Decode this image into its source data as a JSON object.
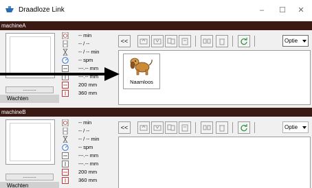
{
  "window": {
    "title": "Draadloze Link"
  },
  "machines": [
    {
      "name": "machineA",
      "button_dots": "..........",
      "status": "Wachten",
      "stats": [
        "-- min",
        "-- / --",
        "-- / -- min",
        "-- spm",
        "---.-- mm",
        "---.-- mm",
        "200 mm",
        "360 mm"
      ],
      "back_label": "<<",
      "option_label": "Optie",
      "items": [
        {
          "label": "Naamloos"
        }
      ]
    },
    {
      "name": "machineB",
      "button_dots": "..........",
      "status": "Wachten",
      "stats": [
        "-- min",
        "-- / --",
        "-- / -- min",
        "-- spm",
        "---.-- mm",
        "---.-- mm",
        "200 mm",
        "360 mm"
      ],
      "back_label": "<<",
      "option_label": "Optie",
      "items": []
    }
  ],
  "icons": {
    "stats": [
      "clock-icon",
      "counter-icon",
      "hourglass-icon",
      "speed-icon",
      "width-icon",
      "height-icon",
      "hoop-width-icon",
      "hoop-height-icon"
    ]
  }
}
